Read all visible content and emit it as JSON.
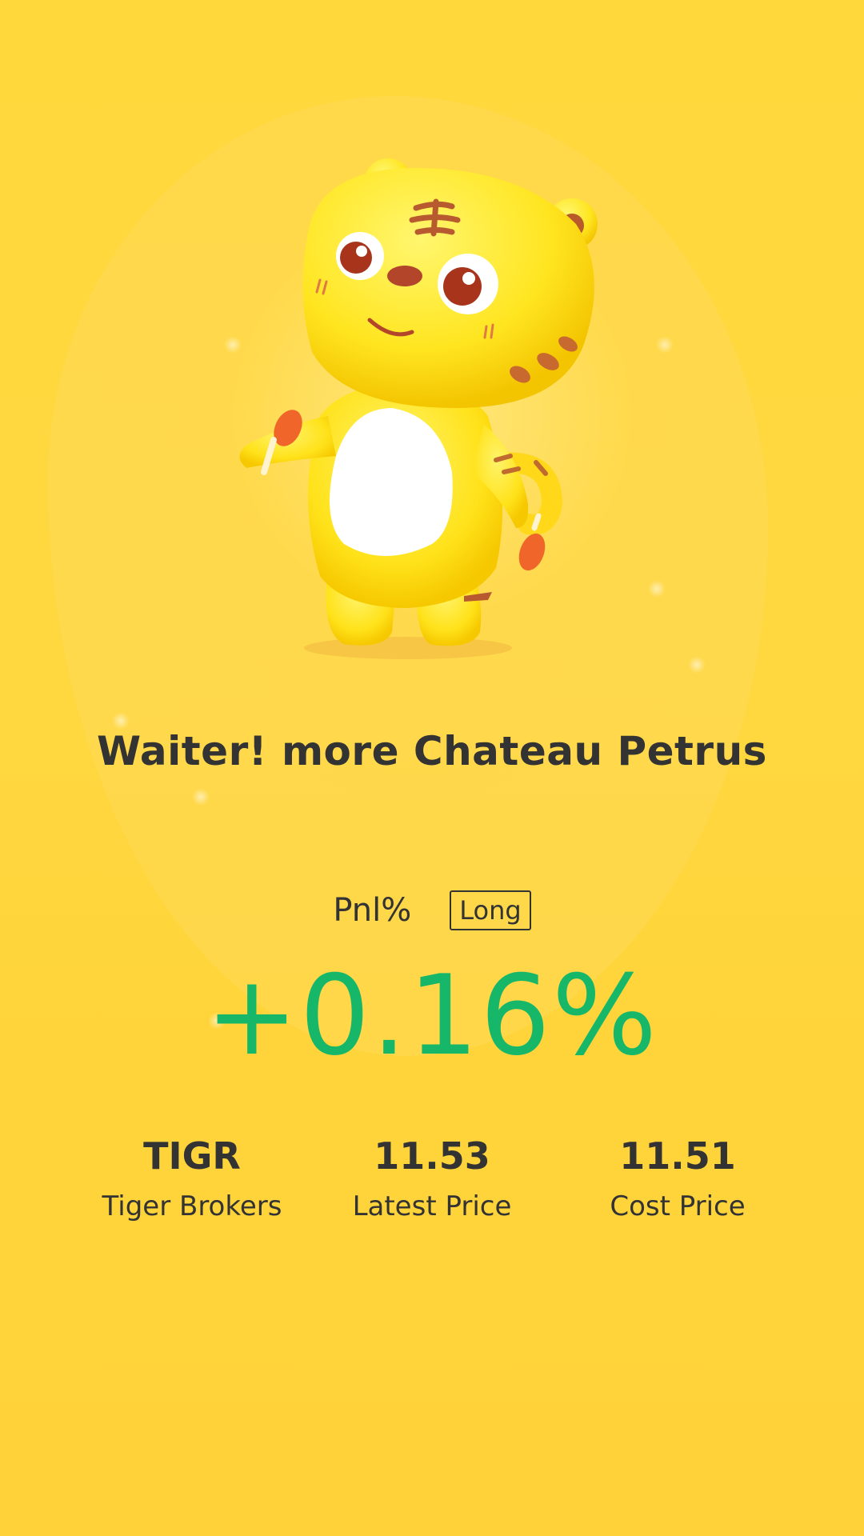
{
  "title": "Waiter! more Chateau Petrus",
  "pnl": {
    "label": "Pnl%",
    "position_tag": "Long",
    "value": "+0.16%"
  },
  "stats": [
    {
      "value": "TIGR",
      "label": "Tiger Brokers"
    },
    {
      "value": "11.53",
      "label": "Latest Price"
    },
    {
      "value": "11.51",
      "label": "Cost Price"
    }
  ],
  "colors": {
    "background": "#ffd83c",
    "text": "#333333",
    "gain": "#17b76a"
  },
  "mascot": {
    "icon": "tiger-mascot-icon"
  }
}
